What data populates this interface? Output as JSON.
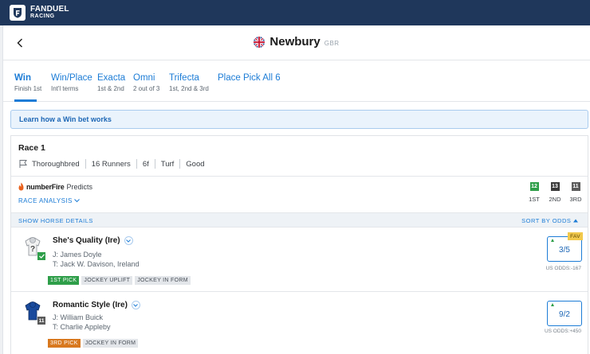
{
  "brand": {
    "line1": "FANDUEL",
    "line2": "RACING"
  },
  "header": {
    "track": "Newbury",
    "country": "GBR"
  },
  "tabs": [
    {
      "label": "Win",
      "sub": "Finish 1st"
    },
    {
      "label": "Win/Place",
      "sub": "Int'l terms"
    },
    {
      "label": "Exacta",
      "sub": "1st & 2nd"
    },
    {
      "label": "Omni",
      "sub": "2 out of 3"
    },
    {
      "label": "Trifecta",
      "sub": "1st, 2nd & 3rd"
    },
    {
      "label": "Place Pick All 6",
      "sub": ""
    }
  ],
  "learn": "Learn how a Win bet works",
  "race": {
    "title": "Race 1",
    "meta": [
      "Thoroughbred",
      "16 Runners",
      "6f",
      "Turf",
      "Good"
    ]
  },
  "predicts": {
    "brand": "numberFire",
    "label": "Predicts",
    "analysis": "RACE ANALYSIS",
    "picks": [
      {
        "num": "12",
        "place": "1ST",
        "color": "#2e9e49"
      },
      {
        "num": "13",
        "place": "2ND",
        "color": "#3a3a3a"
      },
      {
        "num": "11",
        "place": "3RD",
        "color": "#5a5a5a"
      }
    ]
  },
  "list": {
    "show_details": "SHOW HORSE DETAILS",
    "sort": "SORT BY ODDS"
  },
  "runners": [
    {
      "name": "She's Quality (Ire)",
      "jockey": "J: James Doyle",
      "trainer": "T: Jack W. Davison, Ireland",
      "badges": [
        "1ST PICK",
        "JOCKEY UPLIFT",
        "JOCKEY IN FORM"
      ],
      "odds": "3/5",
      "fav": "FAV",
      "us_odds": "US ODDS:-167",
      "cloth_color": "#2e9e49"
    },
    {
      "name": "Romantic Style (Ire)",
      "jockey": "J: William Buick",
      "trainer": "T: Charlie Appleby",
      "badges": [
        "3RD PICK",
        "JOCKEY IN FORM"
      ],
      "odds": "9/2",
      "us_odds": "US ODDS:+450",
      "cloth": "11",
      "cloth_color": "#5a5a5a"
    }
  ]
}
